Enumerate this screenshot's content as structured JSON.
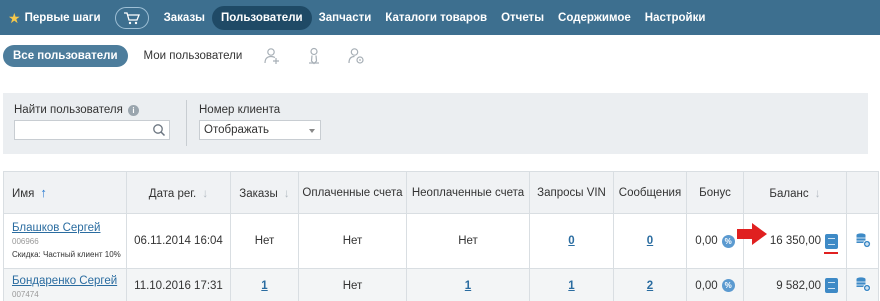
{
  "nav": {
    "first_steps": "Первые шаги",
    "items": [
      "Заказы",
      "Пользователи",
      "Запчасти",
      "Каталоги товаров",
      "Отчеты",
      "Содержимое",
      "Настройки"
    ],
    "active_index": 1
  },
  "subnav": {
    "all_users": "Все пользователи",
    "my_users": "Мои пользователи",
    "icons": [
      "add-user-icon",
      "user-icon",
      "user-settings-icon"
    ]
  },
  "filters": {
    "search_label": "Найти пользователя",
    "search_value": "",
    "client_label": "Номер клиента",
    "client_value": "Отображать"
  },
  "table": {
    "headers": {
      "name": "Имя",
      "reg_date": "Дата рег.",
      "orders": "Заказы",
      "paid": "Оплаченные счета",
      "unpaid": "Неоплаченные счета",
      "vin": "Запросы VIN",
      "messages": "Сообщения",
      "bonus": "Бонус",
      "balance": "Баланс"
    },
    "rows": [
      {
        "name": "Блашков Сергей",
        "id": "006966",
        "discount": "Скидка: Частный клиент 10%",
        "reg_date": "06.11.2014 16:04",
        "orders": "Нет",
        "paid": "Нет",
        "unpaid": "Нет",
        "vin": "0",
        "messages": "0",
        "bonus": "0,00",
        "balance": "16 350,00"
      },
      {
        "name": "Бондаренко Сергей",
        "id": "007474",
        "reg_date": "11.10.2016 17:31",
        "orders": "1",
        "paid": "Нет",
        "unpaid": "1",
        "vin": "1",
        "messages": "2",
        "bonus": "0,00",
        "balance": "9 582,00"
      }
    ]
  },
  "colors": {
    "nav_bg": "#3d6f8f",
    "nav_active": "#1f4a66",
    "link": "#2a6ca0",
    "highlight_arrow": "#e02020"
  }
}
